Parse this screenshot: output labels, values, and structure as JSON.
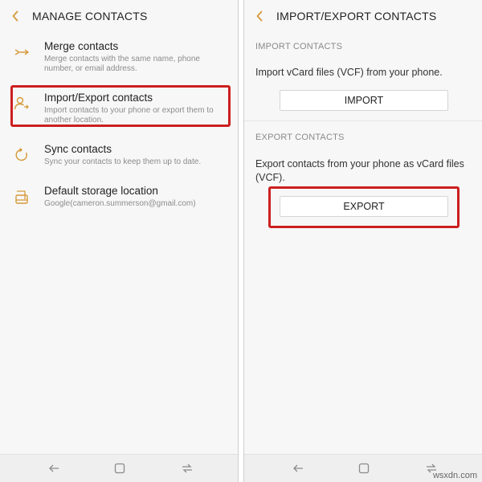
{
  "colors": {
    "accent": "#d69a3a",
    "highlight": "#cc1f1f"
  },
  "left": {
    "title": "MANAGE CONTACTS",
    "items": [
      {
        "title": "Merge contacts",
        "desc": "Merge contacts with the same name, phone number, or email address.",
        "icon": "merge-icon"
      },
      {
        "title": "Import/Export contacts",
        "desc": "Import contacts to your phone or export them to another location.",
        "icon": "import-export-icon"
      },
      {
        "title": "Sync contacts",
        "desc": "Sync your contacts to keep them up to date.",
        "icon": "sync-icon"
      },
      {
        "title": "Default storage location",
        "desc": "Google(cameron.summerson@gmail.com)",
        "icon": "storage-icon"
      }
    ]
  },
  "right": {
    "title": "IMPORT/EXPORT CONTACTS",
    "import_section": {
      "label": "IMPORT CONTACTS",
      "text": "Import vCard files (VCF) from your phone.",
      "button": "IMPORT"
    },
    "export_section": {
      "label": "EXPORT CONTACTS",
      "text": "Export contacts from your phone as vCard files (VCF).",
      "button": "EXPORT"
    }
  },
  "watermark": "wsxdn.com"
}
